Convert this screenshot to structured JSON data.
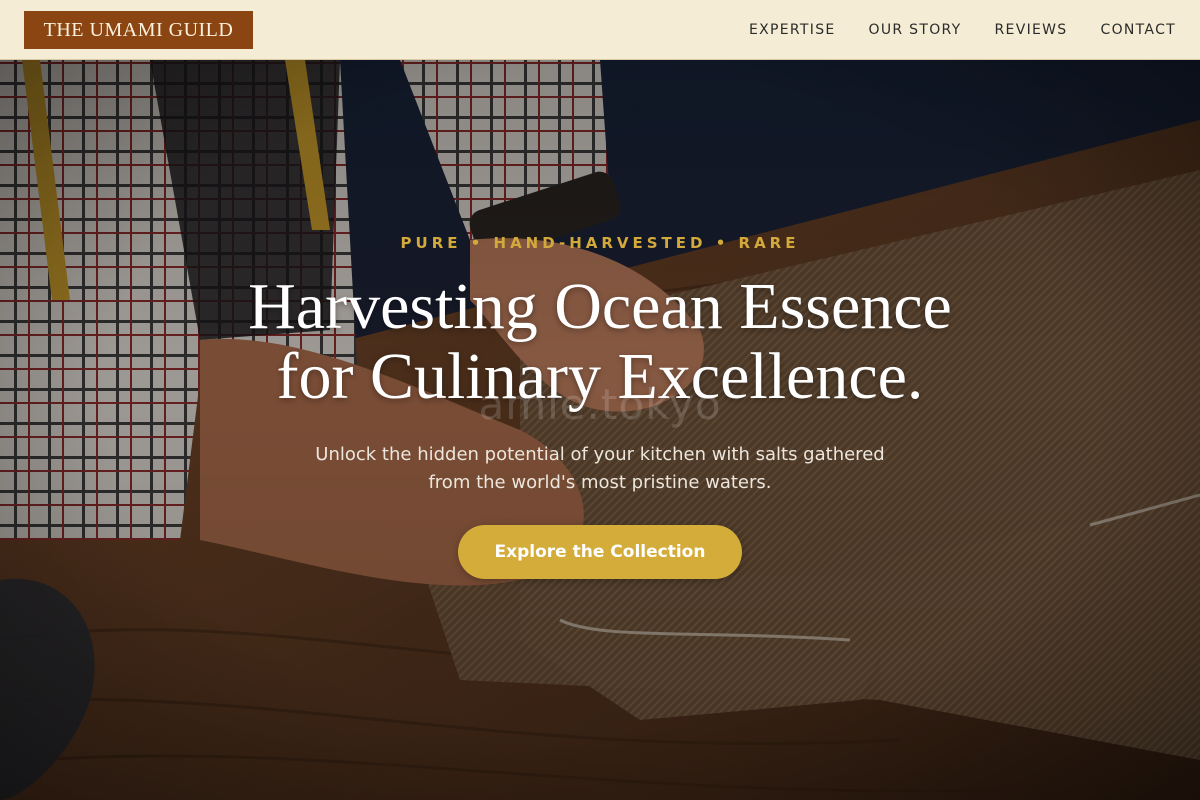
{
  "navbar": {
    "logo_text": "THE UMAMI GUILD",
    "links": [
      {
        "label": "EXPERTISE"
      },
      {
        "label": "OUR STORY"
      },
      {
        "label": "REVIEWS"
      },
      {
        "label": "CONTACT"
      }
    ]
  },
  "hero": {
    "eyebrow": "PURE • HAND-HARVESTED • RARE",
    "headline_line1": "Harvesting Ocean Essence",
    "headline_line2": "for Culinary Excellence.",
    "subtitle_line1": "Unlock the hidden potential of your kitchen with salts gathered",
    "subtitle_line2": "from the world's most pristine waters.",
    "cta_label": "Explore the Collection",
    "watermark": "amie.tokyo"
  },
  "colors": {
    "logo_bg": "#8b4513",
    "navbar_bg": "#f4ecd4",
    "accent_gold": "#d4ac3a",
    "eyebrow_gold": "#d4a93c",
    "headline": "#ffffff"
  }
}
